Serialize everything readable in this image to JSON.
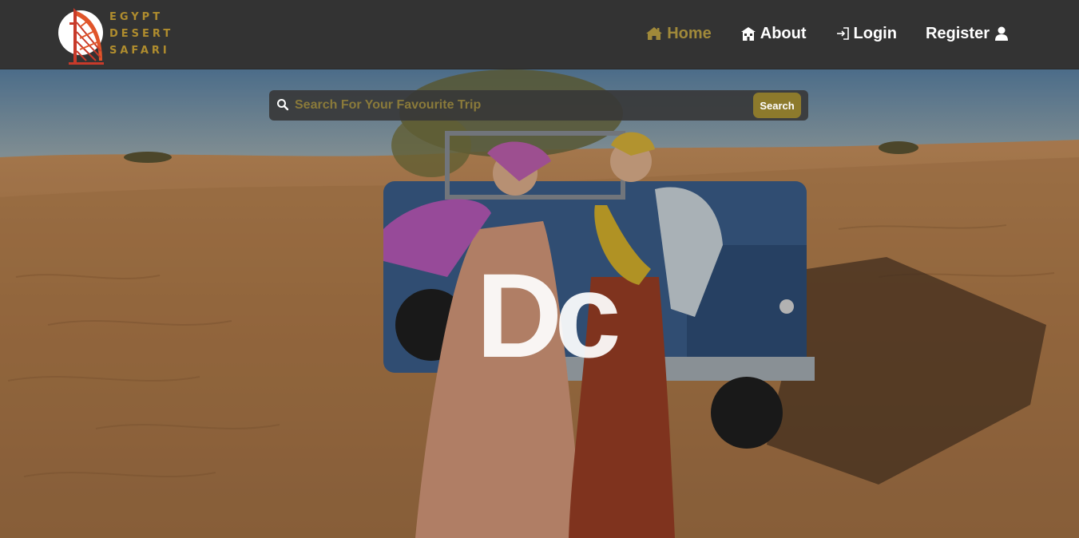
{
  "brand": {
    "logo_lines": [
      "EGYPT",
      "DESERT",
      "SAFARI"
    ],
    "logo_icon": "burj-al-arab-icon",
    "accent_color": "#b08d2e"
  },
  "nav": {
    "items": [
      {
        "label": "Home",
        "icon": "home-icon",
        "active": true
      },
      {
        "label": "About",
        "icon": "building-icon",
        "active": false
      },
      {
        "label": "Login",
        "icon": "login-icon",
        "active": false
      },
      {
        "label": "Register",
        "icon": "user-icon",
        "active": false
      }
    ],
    "active_color": "#a0893a"
  },
  "search": {
    "placeholder": "Search For Your Favourite Trip",
    "value": "",
    "button_label": "Search",
    "icon": "search-icon",
    "button_color": "#8d7a2c"
  },
  "hero": {
    "scene": "desert-jeep-photo",
    "letters": "Dc"
  }
}
